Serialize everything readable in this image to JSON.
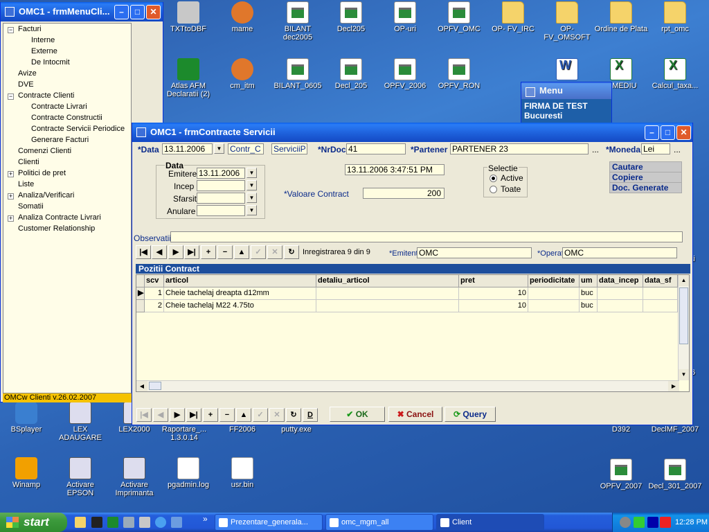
{
  "desktop": {
    "icons": [
      {
        "label": "TXTtoDBF",
        "icon": "seven"
      },
      {
        "label": "mame",
        "icon": "fox"
      },
      {
        "label": "BILANT dec2005",
        "icon": "doc"
      },
      {
        "label": "Decl205",
        "icon": "doc"
      },
      {
        "label": "OP-uri",
        "icon": "doc"
      },
      {
        "label": "OPFV_OMC",
        "icon": "doc"
      },
      {
        "label": "OP- FV_IRC",
        "icon": "folder"
      },
      {
        "label": "OP-FV_OMSOFT",
        "icon": "folder"
      },
      {
        "label": "Ordine de Plata",
        "icon": "folder"
      },
      {
        "label": "rpt_omc",
        "icon": "folder"
      },
      {
        "label": "Atlas AFM Declaratii (2)",
        "icon": "green"
      },
      {
        "label": "cm_itm",
        "icon": "fox"
      },
      {
        "label": "BILANT_0605",
        "icon": "doc"
      },
      {
        "label": "Decl_205",
        "icon": "doc"
      },
      {
        "label": "OPFV_2006",
        "icon": "doc"
      },
      {
        "label": "OPFV_RON",
        "icon": "doc"
      },
      {
        "label": "",
        "icon": "word"
      },
      {
        "label": "A MEDIU",
        "icon": "xls"
      },
      {
        "label": "Calcul_taxa...",
        "icon": "xls"
      },
      {
        "label": "BSplayer",
        "icon": "bs"
      },
      {
        "label": "LEX ADAUGARE",
        "icon": "exe"
      },
      {
        "label": "LEX2000",
        "icon": "exe"
      },
      {
        "label": "Raportare_... 1.3.0.14",
        "icon": "exe"
      },
      {
        "label": "FF2006",
        "icon": "exe"
      },
      {
        "label": "putty.exe",
        "icon": "exe"
      },
      {
        "label": "D392",
        "icon": "doc"
      },
      {
        "label": "DeclMF_2007",
        "icon": "doc"
      },
      {
        "label": "Winamp",
        "icon": "amp"
      },
      {
        "label": "Activare EPSON",
        "icon": "exe"
      },
      {
        "label": "Activare Imprimanta",
        "icon": "exe"
      },
      {
        "label": "pgadmin.log",
        "icon": "txt"
      },
      {
        "label": "usr.bin",
        "icon": "txt"
      },
      {
        "label": "OPFV_2007",
        "icon": "doc"
      },
      {
        "label": "Decl_301_2007",
        "icon": "doc"
      }
    ],
    "edge_text_1": "ti",
    "edge_text_2": "6"
  },
  "menu_window": {
    "title": "OMC1 - frmMenuCli...",
    "version": "OMCw Clienti v.26.02.2007",
    "tree": [
      {
        "label": "Facturi",
        "level": 0,
        "expander": "−"
      },
      {
        "label": "Interne",
        "level": 1
      },
      {
        "label": "Externe",
        "level": 1
      },
      {
        "label": "De Intocmit",
        "level": 1
      },
      {
        "label": "Avize",
        "level": 0
      },
      {
        "label": "DVE",
        "level": 0
      },
      {
        "label": "Contracte Clienti",
        "level": 0,
        "expander": "−"
      },
      {
        "label": "Contracte Livrari",
        "level": 1
      },
      {
        "label": "Contracte Constructii",
        "level": 1
      },
      {
        "label": "Contracte Servicii Periodice",
        "level": 1
      },
      {
        "label": "Generare Facturi",
        "level": 1
      },
      {
        "label": "Comenzi Clienti",
        "level": 0
      },
      {
        "label": "Clienti",
        "level": 0
      },
      {
        "label": "Politici de pret",
        "level": 0,
        "expander": "+"
      },
      {
        "label": "Liste",
        "level": 0
      },
      {
        "label": "Analiza/Verificari",
        "level": 0,
        "expander": "+"
      },
      {
        "label": "Somatii",
        "level": 0
      },
      {
        "label": "Analiza Contracte Livrari",
        "level": 0,
        "expander": "+"
      },
      {
        "label": "Customer Relationship",
        "level": 0
      }
    ]
  },
  "small_window": {
    "title": "Menu",
    "line1": "FIRMA DE TEST",
    "line2": "Bucuresti"
  },
  "main_window": {
    "title": "OMC1 - frmContracte Servicii",
    "header": {
      "data_label": "*Data",
      "data_value": "13.11.2006",
      "contr_value": "Contr_C",
      "tip_value": "ServiciiP",
      "nrdoc_label": "*NrDoc",
      "nrdoc_value": "41",
      "partener_label": "*Partener",
      "partener_value": "PARTENER 23",
      "moneda_label": "*Moneda",
      "moneda_value": "Lei",
      "ellipsis": "..."
    },
    "dates": {
      "group_label": "Data",
      "emitere_label": "Emitere",
      "emitere_value": "13.11.2006",
      "incep_label": "Incep",
      "incep_value": "",
      "sfarsit_label": "Sfarsit",
      "sfarsit_value": "",
      "anulare_label": "Anulare",
      "anulare_value": ""
    },
    "timestamp": "13.11.2006 3:47:51 PM",
    "valoare_label": "*Valoare Contract",
    "valoare_value": "200",
    "selectie": {
      "label": "Selectie",
      "active": "Active",
      "toate": "Toate",
      "selected": "Active"
    },
    "right_buttons": [
      "Cautare",
      "Copiere",
      "Doc. Generate"
    ],
    "observatii_label": "Observatii",
    "observatii_value": "",
    "nav": {
      "record_text": "Inregistrarea 9 din 9"
    },
    "emitent_label": "*Emitent",
    "emitent_value": "OMC",
    "operat_label": "*Operat",
    "operat_value": "OMC",
    "grid": {
      "title": "Pozitii Contract",
      "columns": [
        "scv",
        "articol",
        "detaliu_articol",
        "pret",
        "periodicitate",
        "um",
        "data_incep",
        "data_sf"
      ],
      "rows": [
        {
          "scv": "1",
          "articol": "Cheie tachelaj dreapta d12mm",
          "detaliu_articol": "",
          "pret": "10",
          "periodicitate": "",
          "um": "buc",
          "data_incep": "",
          "data_sf": ""
        },
        {
          "scv": "2",
          "articol": "Cheie tachelaj M22 4.75to",
          "detaliu_articol": "",
          "pret": "10",
          "periodicitate": "",
          "um": "buc",
          "data_incep": "",
          "data_sf": ""
        }
      ]
    },
    "bottom": {
      "d_label": "D",
      "ok_label": "OK",
      "cancel_label": "Cancel",
      "query_label": "Query"
    }
  },
  "taskbar": {
    "start_label": "start",
    "overflow": "»",
    "tasks": [
      {
        "label": "Prezentare_generala...",
        "active": false
      },
      {
        "label": "omc_mgm_all",
        "active": false
      },
      {
        "label": "Client",
        "active": true
      }
    ],
    "clock": "12:28 PM"
  },
  "colors": {
    "window_border": "#0831d9",
    "field_bg": "#fffde0",
    "grid_header": "#1d4e9c",
    "taskbar": "#245edb",
    "start": "#3c9a3c"
  }
}
